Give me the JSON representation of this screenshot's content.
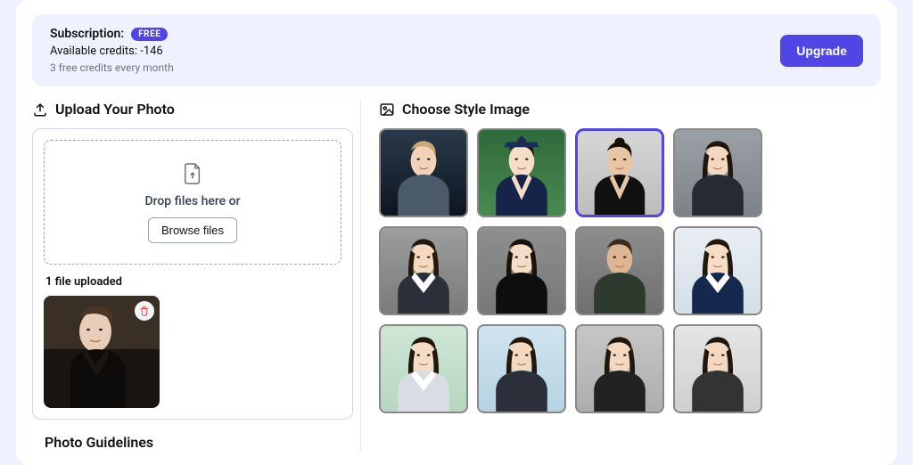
{
  "subscription": {
    "label": "Subscription:",
    "plan": "FREE",
    "credits_line": "Available credits: -146",
    "refresh_note": "3 free credits every month",
    "upgrade_label": "Upgrade"
  },
  "upload": {
    "title": "Upload Your Photo",
    "drop_text": "Drop files here or",
    "browse_label": "Browse files",
    "uploaded_count_label": "1 file uploaded"
  },
  "guidelines": {
    "title": "Photo Guidelines"
  },
  "style": {
    "title": "Choose Style Image",
    "selected_index": 2,
    "items": [
      {
        "name": "style-armor"
      },
      {
        "name": "style-graduation"
      },
      {
        "name": "style-athletic"
      },
      {
        "name": "style-business-1"
      },
      {
        "name": "style-business-2"
      },
      {
        "name": "style-black-top"
      },
      {
        "name": "style-military"
      },
      {
        "name": "style-blazer-1"
      },
      {
        "name": "style-blazer-2"
      },
      {
        "name": "style-extra-1"
      },
      {
        "name": "style-extra-2"
      },
      {
        "name": "style-extra-3"
      }
    ]
  }
}
